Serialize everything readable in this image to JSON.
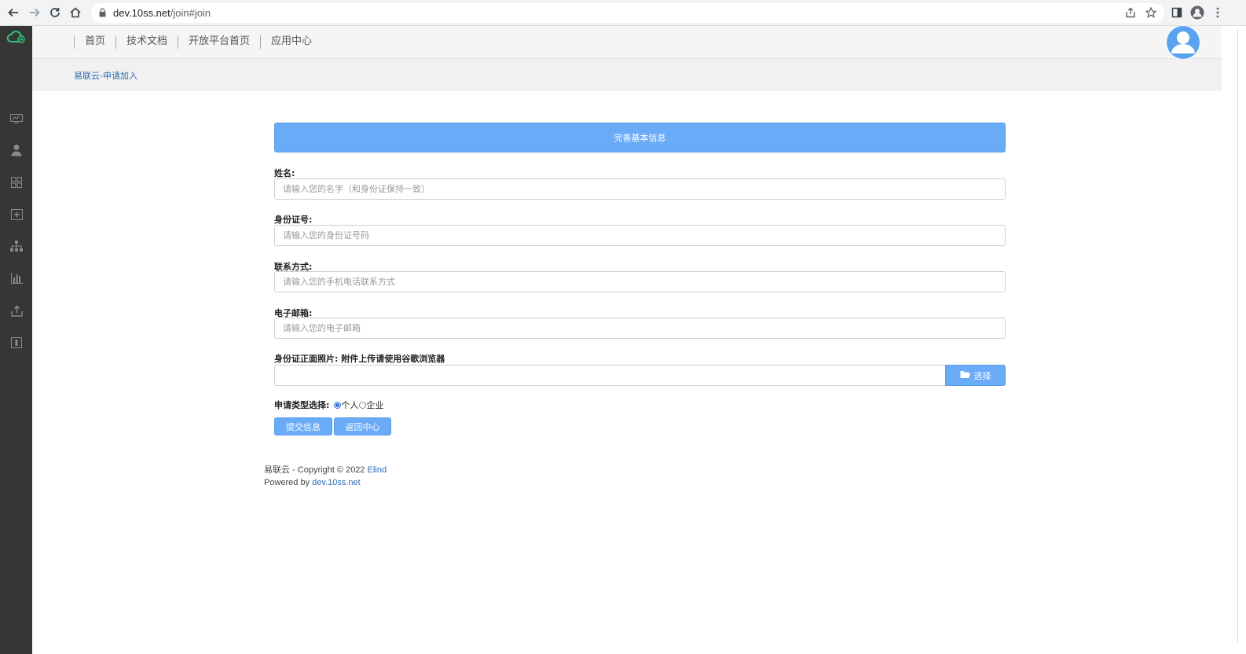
{
  "browser": {
    "url_host": "dev.10ss.net",
    "url_path": "/join#join"
  },
  "header": {
    "menu": [
      "首页",
      "技术文档",
      "开放平台首页",
      "应用中心"
    ]
  },
  "sidebar": {
    "icons": [
      "dashboard-icon",
      "user-icon",
      "grid-icon",
      "add-box-icon",
      "org-tree-icon",
      "bar-chart-icon",
      "upload-icon",
      "info-box-icon"
    ]
  },
  "breadcrumb": "易联云-申请加入",
  "form": {
    "header": "完善基本信息",
    "name": {
      "label": "姓名:",
      "placeholder": "请输入您的名字（和身份证保持一致）"
    },
    "id_number": {
      "label": "身份证号:",
      "placeholder": "请输入您的身份证号码"
    },
    "phone": {
      "label": "联系方式:",
      "placeholder": "请输入您的手机电话联系方式"
    },
    "email": {
      "label": "电子邮箱:",
      "placeholder": "请输入您的电子邮箱"
    },
    "id_photo": {
      "label": "身份证正面照片:  附件上传请使用谷歌浏览器",
      "button": "选择"
    },
    "apply_type": {
      "label": "申请类型选择:",
      "options": [
        "个人",
        "企业"
      ],
      "selected": "个人"
    },
    "submit_button": "提交信息",
    "back_button": "返回中心"
  },
  "footer": {
    "line1_prefix": "易联云 - Copyright © 2022 ",
    "line1_link": "Elind",
    "line2_prefix": "Powered by ",
    "line2_link": "dev.10ss.net"
  },
  "colors": {
    "primary": "#6aabf7",
    "sidebar": "#363636",
    "logo": "#2fc27a",
    "link": "#2d6cb3"
  }
}
